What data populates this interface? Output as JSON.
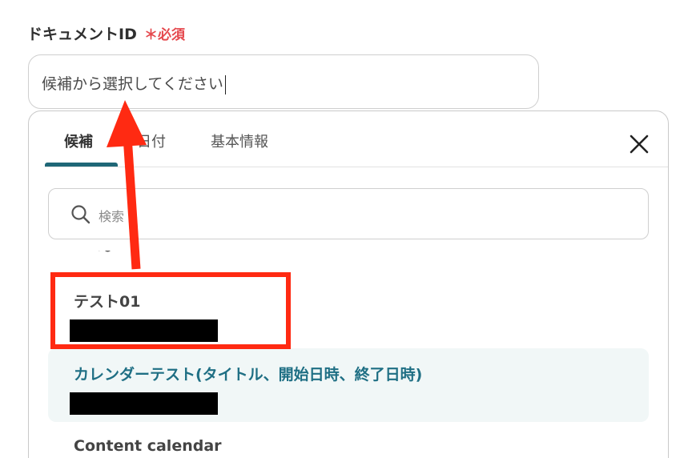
{
  "field": {
    "label": "ドキュメントID",
    "required_mark": "＊必須",
    "input_value": "候補から選択してください"
  },
  "dropdown": {
    "tabs": [
      {
        "label": "候補",
        "active": true
      },
      {
        "label": "日付",
        "active": false
      },
      {
        "label": "基本情報",
        "active": false
      }
    ],
    "search_placeholder": "検索",
    "partial_item_text": "〜",
    "options": [
      {
        "title": "テスト01",
        "selected": false
      },
      {
        "title": "カレンダーテスト(タイトル、開始日時、終了日時)",
        "selected": true
      },
      {
        "title": "Content calendar",
        "selected": false
      }
    ]
  },
  "colors": {
    "accent": "#1f6777",
    "selected_text": "#1f6f84",
    "selected_bg": "#f1f7f7",
    "required": "#e5484d",
    "annotation": "#ff2a12"
  },
  "icons": {
    "close": "close-icon",
    "search": "search-icon"
  }
}
